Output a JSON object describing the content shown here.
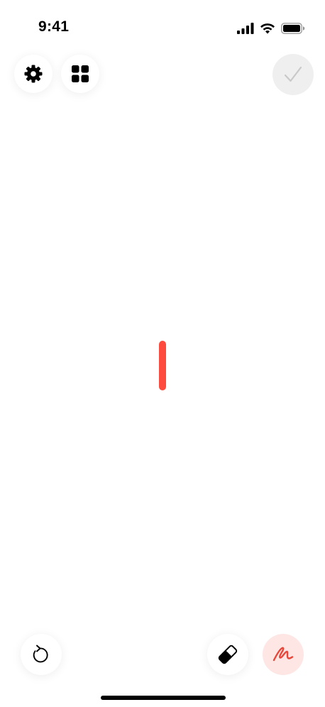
{
  "status_bar": {
    "time": "9:41",
    "signal_icon": "cellular-signal-icon",
    "wifi_icon": "wifi-icon",
    "battery_icon": "battery-icon"
  },
  "toolbar_top": {
    "settings_icon": "gear-icon",
    "grid_icon": "grid-icon",
    "confirm_icon": "checkmark-icon",
    "confirm_enabled": false
  },
  "canvas": {
    "stroke_color": "#ff4b3e"
  },
  "toolbar_bottom": {
    "undo_icon": "undo-icon",
    "eraser_icon": "eraser-icon",
    "pen_icon": "pen-scribble-icon",
    "active_tool": "pen",
    "accent_color": "#e8483b"
  }
}
